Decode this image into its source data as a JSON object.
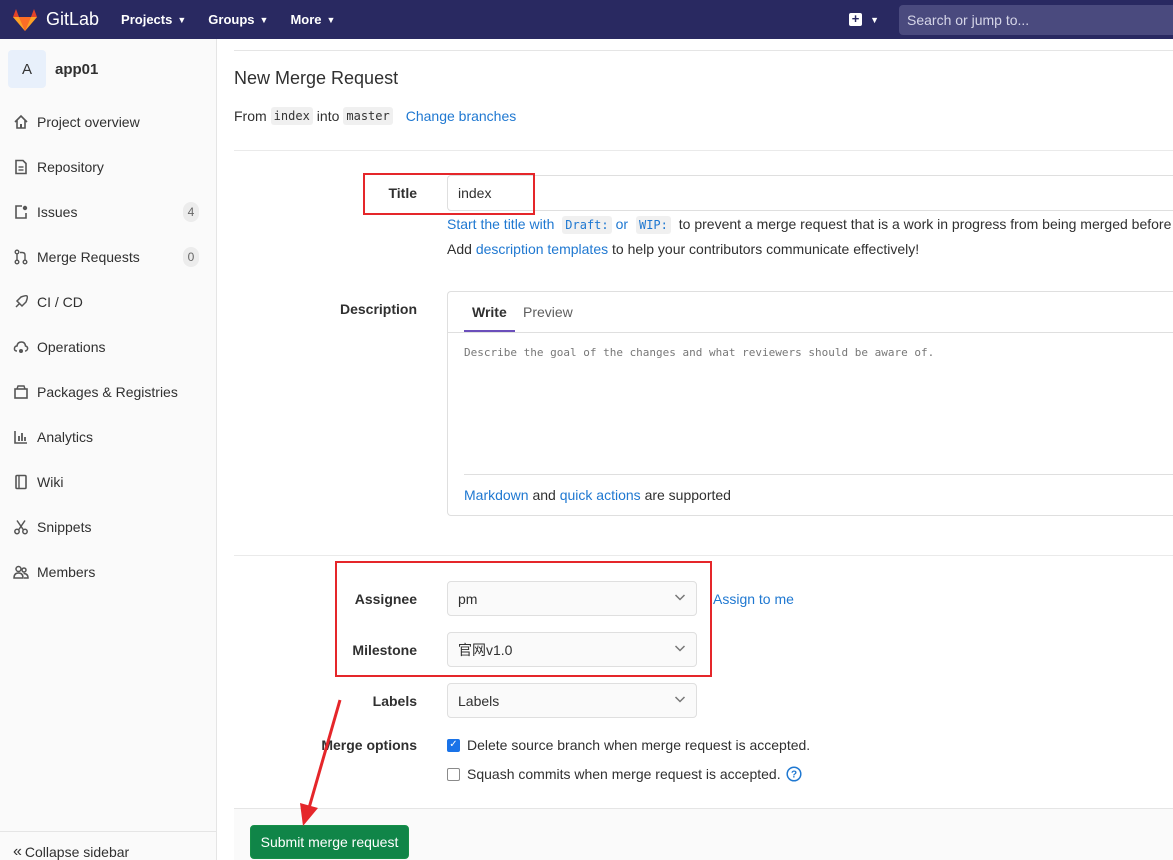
{
  "navbar": {
    "brand": "GitLab",
    "menu": [
      {
        "label": "Projects"
      },
      {
        "label": "Groups"
      },
      {
        "label": "More"
      }
    ],
    "search_placeholder": "Search or jump to..."
  },
  "sidebar": {
    "avatar_letter": "A",
    "project_name": "app01",
    "items": [
      {
        "label": "Project overview",
        "icon": "home-icon"
      },
      {
        "label": "Repository",
        "icon": "doc-icon"
      },
      {
        "label": "Issues",
        "icon": "issues-icon",
        "badge": "4"
      },
      {
        "label": "Merge Requests",
        "icon": "merge-request-icon",
        "badge": "0"
      },
      {
        "label": "CI / CD",
        "icon": "rocket-icon"
      },
      {
        "label": "Operations",
        "icon": "cloud-gear-icon"
      },
      {
        "label": "Packages & Registries",
        "icon": "package-icon"
      },
      {
        "label": "Analytics",
        "icon": "chart-icon"
      },
      {
        "label": "Wiki",
        "icon": "book-icon"
      },
      {
        "label": "Snippets",
        "icon": "scissors-icon"
      },
      {
        "label": "Members",
        "icon": "users-icon"
      }
    ],
    "collapse_label": "Collapse sidebar"
  },
  "main": {
    "title": "New Merge Request",
    "branch": {
      "from_text": "From",
      "source": "index",
      "into_text": "into",
      "target": "master",
      "change_link": "Change branches"
    },
    "title_field": {
      "label": "Title",
      "value": "index"
    },
    "title_hint": {
      "prefix": "Start the title with",
      "draft": "Draft:",
      "or": "or",
      "wip": "WIP:",
      "suffix": "to prevent a merge request that is a work in progress from being merged before i"
    },
    "template_hint": {
      "prefix": "Add",
      "link": "description templates",
      "suffix": "to help your contributors communicate effectively!"
    },
    "description": {
      "label": "Description",
      "tab_write": "Write",
      "tab_preview": "Preview",
      "placeholder": "Describe the goal of the changes and what reviewers should be aware of.",
      "markdown_link": "Markdown",
      "and": "and",
      "quick_actions_link": "quick actions",
      "supported": "are supported"
    },
    "assignee": {
      "label": "Assignee",
      "value": "pm",
      "assign_me": "Assign to me"
    },
    "milestone": {
      "label": "Milestone",
      "value": "官网v1.0"
    },
    "labels": {
      "label": "Labels",
      "value": "Labels"
    },
    "merge_options": {
      "label": "Merge options",
      "delete_branch": "Delete source branch when merge request is accepted.",
      "squash": "Squash commits when merge request is accepted."
    },
    "submit": "Submit merge request"
  },
  "colors": {
    "navbar": "#292961",
    "link": "#1f78d1",
    "submit": "#108548",
    "annotation": "#e5262a"
  }
}
